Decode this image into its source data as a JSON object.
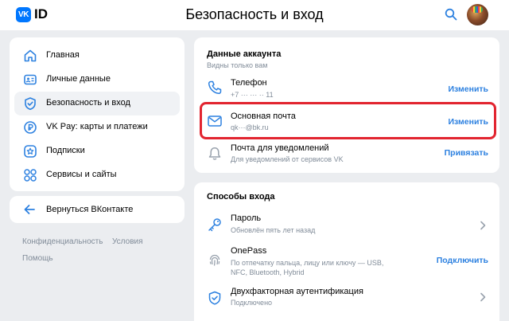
{
  "header": {
    "logo_mark": "VK",
    "logo_text": "ID",
    "title": "Безопасность и вход",
    "search_icon": "search-icon",
    "avatar": "avatar"
  },
  "sidebar": {
    "items": [
      {
        "label": "Главная",
        "icon": "home-icon"
      },
      {
        "label": "Личные данные",
        "icon": "id-card-icon"
      },
      {
        "label": "Безопасность и вход",
        "icon": "shield-icon",
        "active": true
      },
      {
        "label": "VK Pay: карты и платежи",
        "icon": "ruble-icon"
      },
      {
        "label": "Подписки",
        "icon": "star-icon"
      },
      {
        "label": "Сервисы и сайты",
        "icon": "services-grid-icon"
      }
    ],
    "back_label": "Вернуться ВКонтакте"
  },
  "footer": {
    "privacy": "Конфиденциальность",
    "terms": "Условия",
    "help": "Помощь"
  },
  "account": {
    "title": "Данные аккаунта",
    "subtitle": "Видны только вам",
    "rows": [
      {
        "title": "Телефон",
        "value": "+7 ··· ··· ·· 11",
        "action": "Изменить",
        "icon": "phone-icon"
      },
      {
        "title": "Основная почта",
        "value": "qk···@bk.ru",
        "action": "Изменить",
        "icon": "mail-icon",
        "highlighted": true
      },
      {
        "title": "Почта для уведомлений",
        "value": "Для уведомлений от сервисов VK",
        "action": "Привязать",
        "icon": "bell-icon"
      }
    ]
  },
  "login": {
    "title": "Способы входа",
    "rows": [
      {
        "title": "Пароль",
        "value": "Обновлён пять лет назад",
        "icon": "key-icon"
      },
      {
        "title": "OnePass",
        "value_line1": "По отпечатку пальца, лицу или ключу — USB,",
        "value_line2": "NFC, Bluetooth, Hybrid",
        "action": "Подключить",
        "icon": "fingerprint-icon"
      },
      {
        "title": "Двухфакторная аутентификация",
        "value": "Подключено",
        "icon": "shield-check-icon"
      }
    ]
  },
  "colors": {
    "accent": "#2d81e0",
    "brand": "#0077ff",
    "highlight": "#e22530",
    "background": "#ebedf0"
  }
}
